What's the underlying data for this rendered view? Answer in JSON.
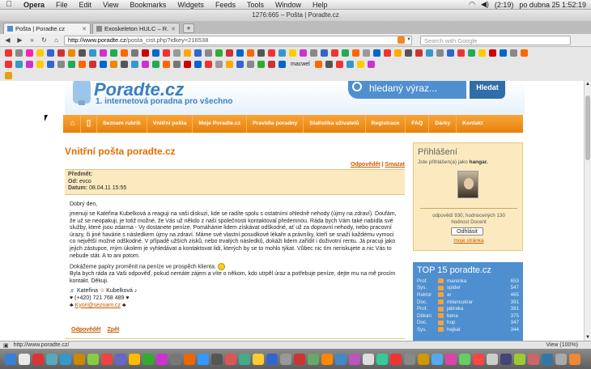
{
  "menubar": {
    "app": "Opera",
    "items": [
      "File",
      "Edit",
      "View",
      "Bookmarks",
      "Widgets",
      "Feeds",
      "Tools",
      "Window",
      "Help"
    ],
    "battery": "(2:19)",
    "clock": "po dubna 25  1:52:19"
  },
  "window": {
    "title": "1276:665 – Pošta | Poradte.cz"
  },
  "tabs": [
    {
      "label": "Pošta | Poradte.cz"
    },
    {
      "label": "Exoskeleton HULC – R..."
    }
  ],
  "address": {
    "url_host": "http://www.poradte.cz",
    "url_path": "/posta_cist.php?idkey=216538",
    "search_placeholder": "Search with Google"
  },
  "bookmarks": {
    "label": "macwel"
  },
  "site": {
    "logo": "Poradte.cz",
    "slogan": "1. internetová poradna pro všechno",
    "search_placeholder": "hledaný výraz...",
    "search_button": "Hledat",
    "nav": [
      "Seznam rubrik",
      "Vnitřní pošta",
      "Moje Poradte.cz",
      "Pravidla poradny",
      "Statistika uživatelů",
      "Registrace",
      "FAQ",
      "Dárky",
      "Kontakt"
    ]
  },
  "mail": {
    "title": "Vnitřní pošta poradte.cz",
    "reply": "Odpovědět",
    "delete": "Smazat",
    "subject_label": "Předmět:",
    "from_label": "Od:",
    "from_value": "evco",
    "date_label": "Datum:",
    "date_value": "08.04.11 15:55",
    "greeting": "Dobrý den,",
    "para1": "jmenuji se Kateřina Kubelková a reaguji na vaši diskuzi, kde se radíte spolu s ostatními ohledně nehody (újmy na zdraví). Doufám, že už se neopakuji, je totiž možné, že Vás už někdo z naší společnosti kontaktoval předemnou. Ráda bych Vám také nabídla své služby, které jsou zdarma - Vy dostanete peníze. Pomáháme lidem získávat odškodné, ať už za dopravní nehody, nebo pracovní úrazy, či jiné havárie s následkem újmy na zdraví. Máme své vlastní posudkové lékaře a právníky, kteří se snaží každému vymoci co největší možné odškodné. V případě užších zisků, nebo trvalých následků, dokáži lidem zařídit i doživotní rentu. Já pracuji jako jejich zástupce, mým úkolem je vyhledávat a kontaktovat lidi, kterých by se to mohlo týkat. Vůbec nic tím neriskujete a nic Vás to nebude stát. A to ani potom.",
    "para2": "Dokážeme papíry proměnit na peníze ve prospěch klienta.",
    "para3": "Byla bych ráda za Vaši odpověď, pokud nemáte zájem a víte o někom, kdo utrpěl úraz a potřebuje peníze, dejte mu na mě prosím kontakt. Děkuji.",
    "sig_name": "♬ Kateřina ☆ Kubelková ♪",
    "sig_phone": "♥ (+420) 721 768 489 ♥",
    "sig_email": "Kyori@seznam.cz",
    "bottom_reply": "Odpovědět",
    "bottom_back": "Zpět"
  },
  "login": {
    "title": "Přihlášení",
    "logged_as_prefix": "Jste přihlášen(a) jako",
    "user": "hangar.",
    "stats1": "odpovědí 930, hodnocených 130",
    "stats2": "hodnost Docent",
    "logout": "Odhlásit",
    "my_links": "moje stránka"
  },
  "top": {
    "title": "TOP 15 poradte.cz",
    "rows": [
      {
        "rank": "Prof.",
        "name": "marenka",
        "points": "653"
      },
      {
        "rank": "Sys.",
        "name": "spider",
        "points": "547"
      },
      {
        "rank": "Rektor",
        "name": "ar",
        "points": "465"
      },
      {
        "rank": "Doc.",
        "name": "milancukrar",
        "points": "391"
      },
      {
        "rank": "Prof.",
        "name": "jabraka",
        "points": "381"
      },
      {
        "rank": "Děkan",
        "name": "bena",
        "points": "375"
      },
      {
        "rank": "Doc.",
        "name": "hop",
        "points": "347"
      },
      {
        "rank": "Sys.",
        "name": "hejkal",
        "points": "344"
      }
    ]
  },
  "status": {
    "url": "http://www.poradte.cz/",
    "zoom": "View (100%)"
  }
}
